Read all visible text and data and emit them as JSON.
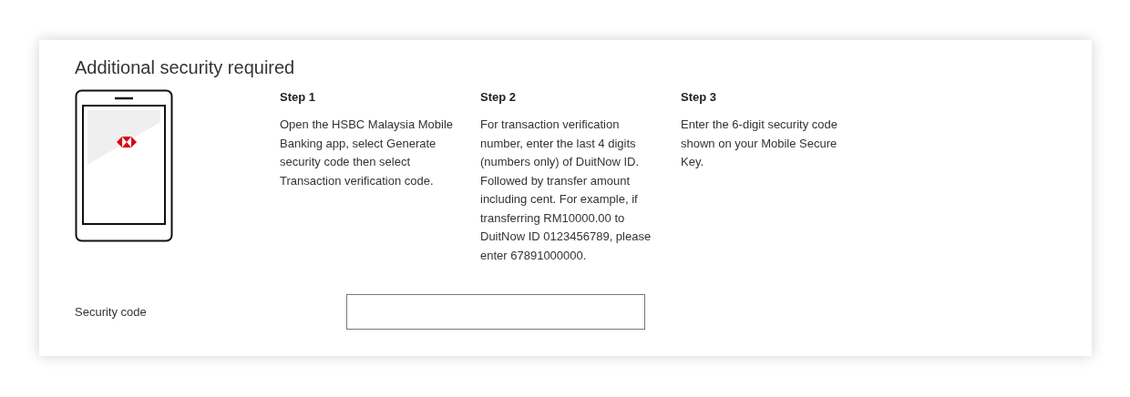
{
  "title": "Additional security required",
  "steps": [
    {
      "heading": "Step 1",
      "text": "Open the HSBC Malaysia Mobile Banking app, select Generate security code then select Transaction verification code."
    },
    {
      "heading": "Step 2",
      "text": "For transaction verification number, enter the last 4 digits (numbers only) of DuitNow ID. Followed by transfer amount including cent. For example, if transferring RM10000.00 to DuitNow ID 0123456789, please enter 67891000000."
    },
    {
      "heading": "Step 3",
      "text": "Enter the 6-digit security code shown on your Mobile Secure Key."
    }
  ],
  "field": {
    "label": "Security code"
  }
}
